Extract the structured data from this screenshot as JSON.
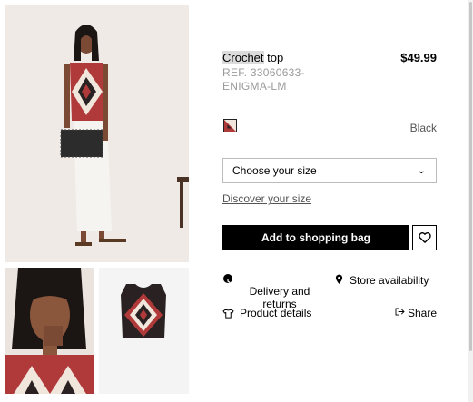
{
  "product": {
    "title_highlight": "Crochet",
    "title_rest": " top",
    "price": "$49.99",
    "reference": "REF. 33060633-ENIGMA-LM",
    "color": "Black"
  },
  "size": {
    "select_label": "Choose your size",
    "discover_link": "Discover your size"
  },
  "actions": {
    "add_to_bag": "Add to shopping bag"
  },
  "info": {
    "delivery": "Delivery and returns",
    "store": "Store availability",
    "details": "Product details",
    "share": "Share"
  },
  "icons": {
    "clock": "clock-icon",
    "pin": "location-pin-icon",
    "shirt": "shirt-icon",
    "share": "share-icon",
    "heart": "heart-icon",
    "chevron": "chevron-down-icon"
  },
  "colors": {
    "button_bg": "#000000",
    "muted_text": "#9a9a9a",
    "pattern_red": "#b03a3a",
    "pattern_cream": "#f1e6dc",
    "pattern_dark": "#2a2222"
  }
}
